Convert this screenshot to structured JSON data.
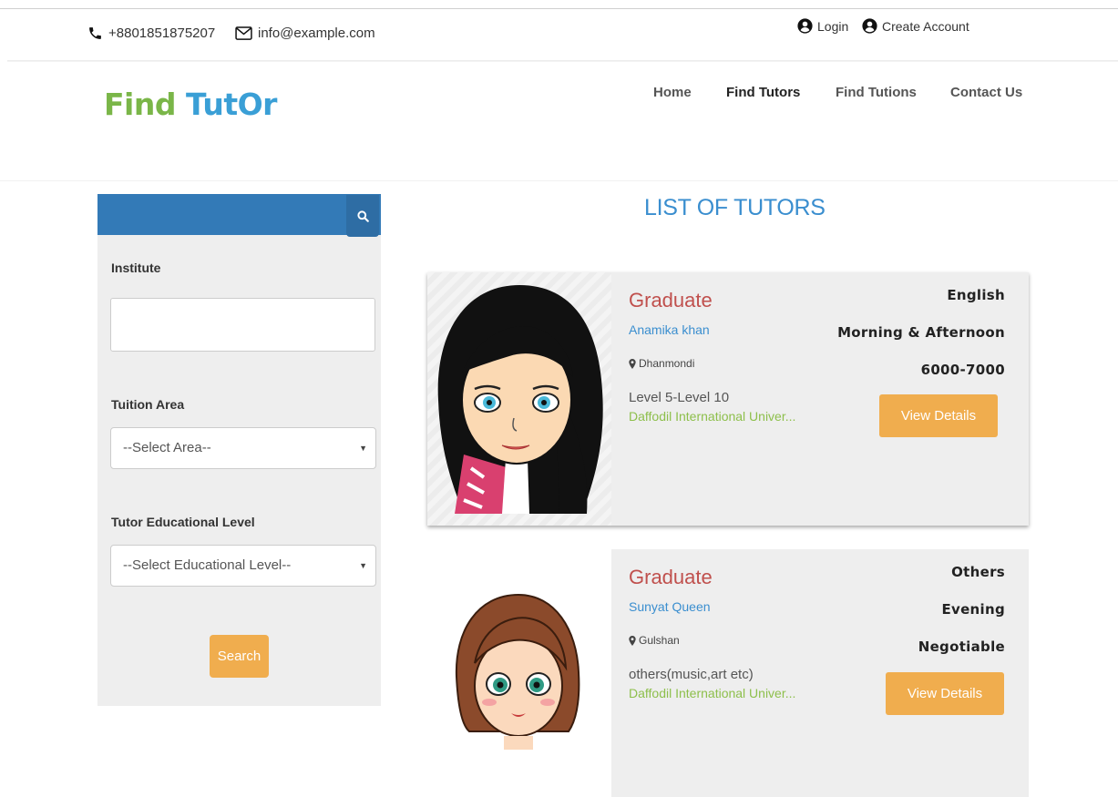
{
  "topbar": {
    "phone": "+8801851875207",
    "email": "info@example.com",
    "login": "Login",
    "create_account": "Create Account"
  },
  "brand": {
    "logo_part1": "Find ",
    "logo_part2": "TutOr"
  },
  "nav": {
    "items": [
      "Home",
      "Find Tutors",
      "Find Tutions",
      "Contact Us"
    ],
    "active": "Find Tutors"
  },
  "sidebar": {
    "institute_label": "Institute",
    "institute_value": "",
    "area_label": "Tuition Area",
    "area_selected": "--Select Area--",
    "level_label": "Tutor Educational Level",
    "level_selected": "--Select Educational Level--",
    "search_button": "Search"
  },
  "main": {
    "title": "LIST OF TUTORS",
    "tutors": [
      {
        "degree": "Graduate",
        "name": "Anamika khan",
        "location": "Dhanmondi",
        "level": "Level 5-Level 10",
        "institute": "Daffodil International Univer...",
        "subject": "English",
        "time": "Morning & Afternoon",
        "salary": "6000-7000",
        "button": "View Details"
      },
      {
        "degree": "Graduate",
        "name": "Sunyat Queen",
        "location": "Gulshan",
        "level": "others(music,art etc)",
        "institute": "Daffodil International Univer...",
        "subject": "Others",
        "time": "Evening",
        "salary": "Negotiable",
        "button": "View Details"
      }
    ]
  },
  "colors": {
    "primary_blue": "#337ab7",
    "button_orange": "#f0ad4e",
    "logo_green": "#7ab648",
    "logo_blue": "#3a9fd6",
    "degree_red": "#c0504d",
    "institute_green": "#8dbf4b"
  },
  "icons": [
    "phone-icon",
    "envelope-icon",
    "user-circle-icon",
    "search-icon",
    "map-marker-icon",
    "caret-down-icon"
  ]
}
